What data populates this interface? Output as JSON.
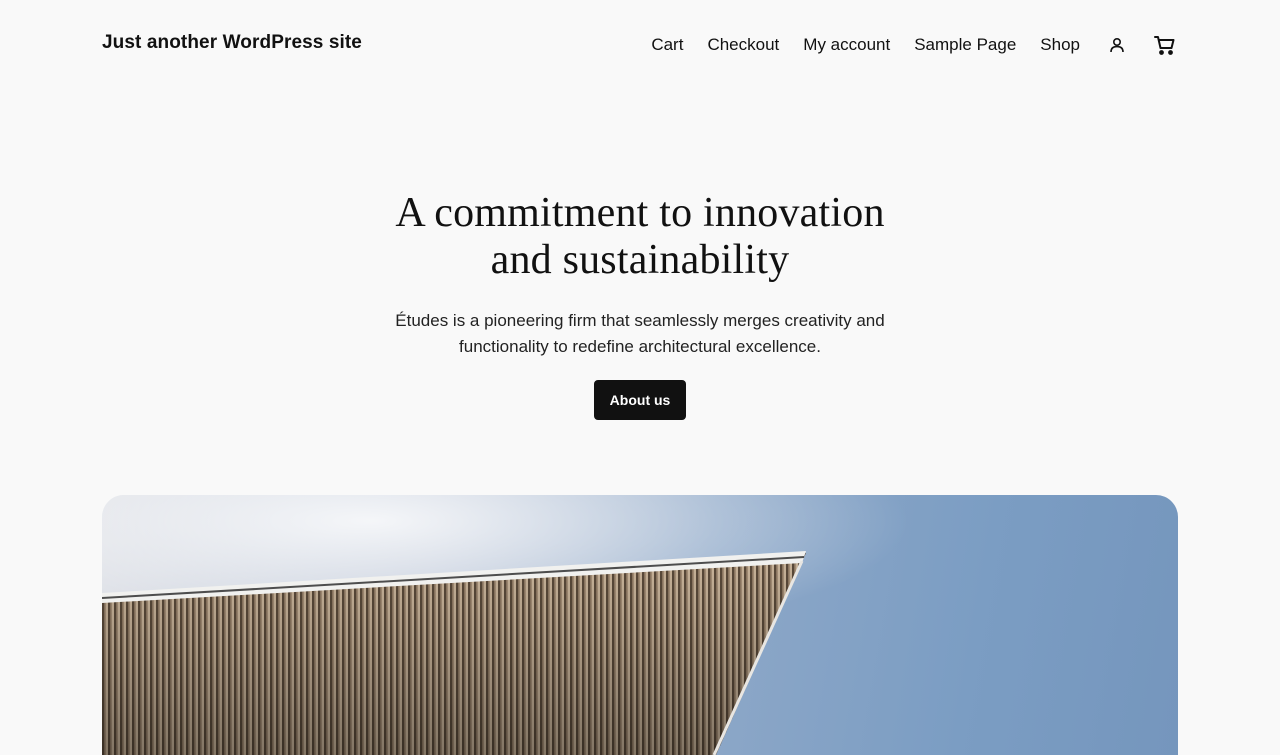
{
  "header": {
    "site_title": "Just another WordPress site",
    "nav": [
      {
        "label": "Cart"
      },
      {
        "label": "Checkout"
      },
      {
        "label": "My account"
      },
      {
        "label": "Sample Page"
      },
      {
        "label": "Shop"
      }
    ],
    "icons": {
      "account": "user-icon",
      "cart": "cart-icon"
    }
  },
  "hero": {
    "title_line1": "A commitment to innovation",
    "title_line2": "and sustainability",
    "description": "Études is a pioneering firm that seamlessly merges creativity and functionality to redefine architectural excellence.",
    "button_label": "About us"
  },
  "theme": {
    "background": "#f9f9f9",
    "text": "#111111",
    "button_bg": "#111111",
    "button_text": "#ffffff"
  }
}
